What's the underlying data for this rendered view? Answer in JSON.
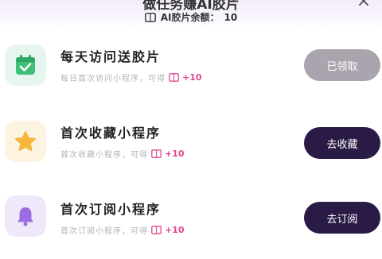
{
  "header": {
    "title": "做任务赚AI胶片",
    "close_symbol": "×",
    "balance_label": "AI胶片余额：",
    "balance_value": "10",
    "icon": "film-icon"
  },
  "tasks": [
    {
      "title": "每天访问送胶片",
      "subtitle": "每日首次访问小程序，可得",
      "reward": "+10",
      "button_label": "已领取",
      "button_state": "done",
      "icon": "calendar-check-icon",
      "icon_bg": "#e6f6ee",
      "icon_color": "#3fbf78"
    },
    {
      "title": "首次收藏小程序",
      "subtitle": "首次收藏小程序，可得",
      "reward": "+10",
      "button_label": "去收藏",
      "button_state": "active",
      "icon": "star-icon",
      "icon_bg": "#fdf3e1",
      "icon_color": "#f6b73c"
    },
    {
      "title": "首次订阅小程序",
      "subtitle": "首次订阅小程序，可得",
      "reward": "+10",
      "button_label": "去订阅",
      "button_state": "active",
      "icon": "bell-icon",
      "icon_bg": "#efe8fb",
      "icon_color": "#9b6ce0"
    }
  ],
  "colors": {
    "accent": "#2a1a46",
    "reward": "#e0478f",
    "disabled": "#a9a4ad"
  }
}
